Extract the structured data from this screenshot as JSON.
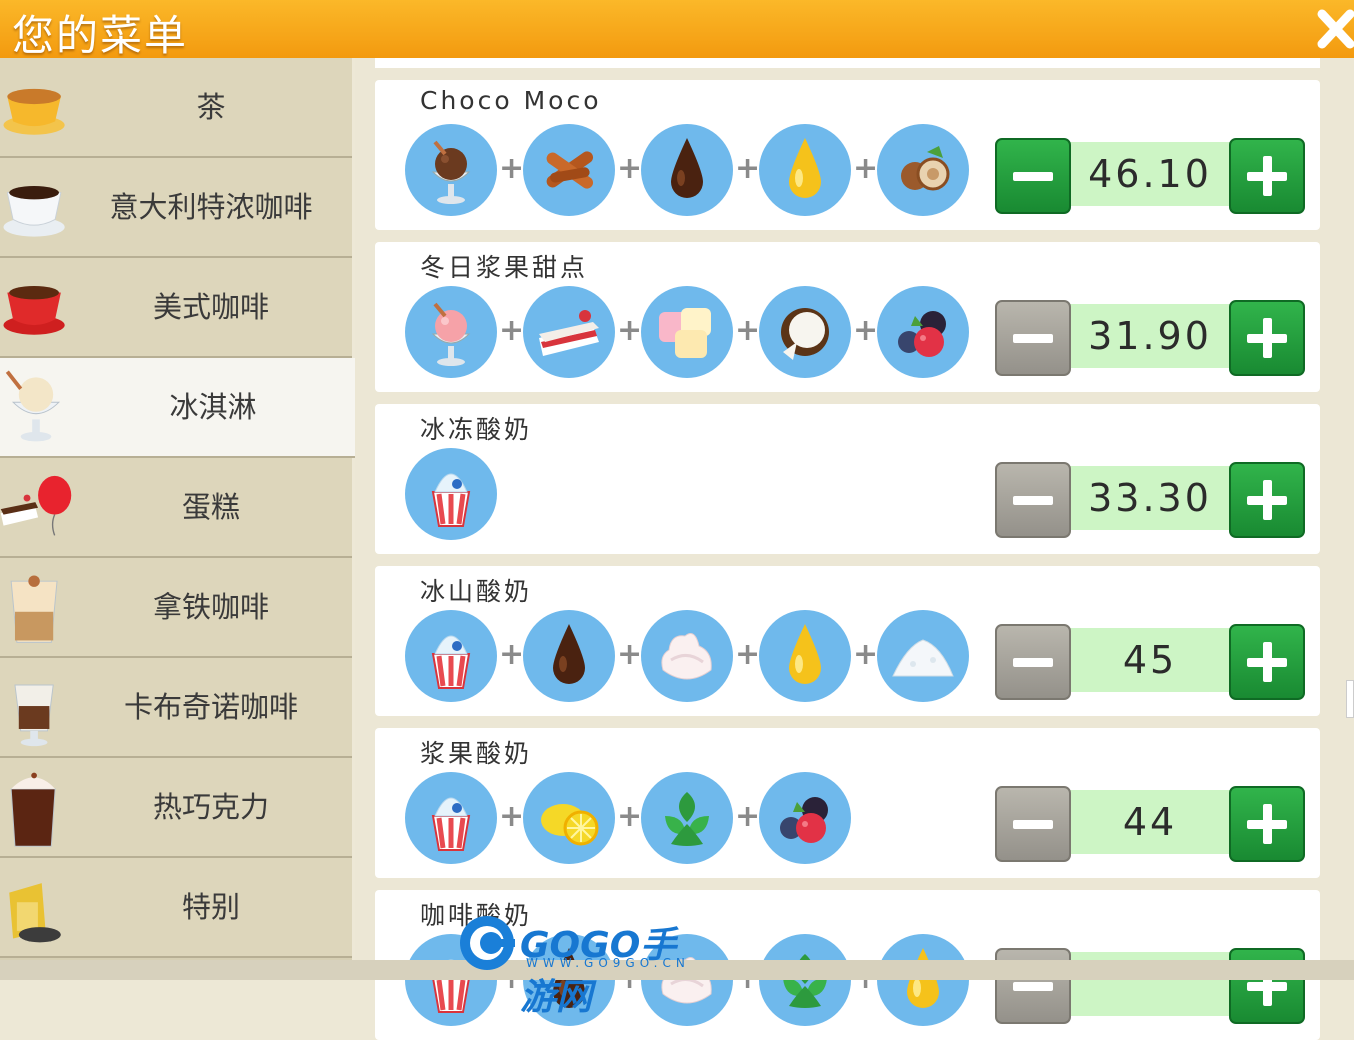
{
  "header": {
    "title": "您的菜单",
    "close_icon": "close-icon"
  },
  "sidebar": {
    "items": [
      {
        "label": "茶",
        "icon": "tea-cup-icon",
        "selected": false
      },
      {
        "label": "意大利特浓咖啡",
        "icon": "espresso-cup-icon",
        "selected": false
      },
      {
        "label": "美式咖啡",
        "icon": "americano-cup-icon",
        "selected": false
      },
      {
        "label": "冰淇淋",
        "icon": "ice-cream-icon",
        "selected": true
      },
      {
        "label": "蛋糕",
        "icon": "cake-balloon-icon",
        "selected": false
      },
      {
        "label": "拿铁咖啡",
        "icon": "latte-glass-icon",
        "selected": false
      },
      {
        "label": "卡布奇诺咖啡",
        "icon": "cappuccino-glass-icon",
        "selected": false
      },
      {
        "label": "热巧克力",
        "icon": "hot-chocolate-icon",
        "selected": false
      },
      {
        "label": "特别",
        "icon": "special-icon",
        "selected": false
      }
    ]
  },
  "recipes": [
    {
      "name": "Choco Moco",
      "price": "46.10",
      "minus_enabled": true,
      "ingredients": [
        "chocolate-ice-cream-icon",
        "cinnamon-icon",
        "chocolate-syrup-icon",
        "honey-drop-icon",
        "hazelnut-icon"
      ]
    },
    {
      "name": "冬日浆果甜点",
      "price": "31.90",
      "minus_enabled": false,
      "ingredients": [
        "strawberry-ice-cream-icon",
        "cake-slice-icon",
        "marshmallow-icon",
        "coconut-icon",
        "berries-icon"
      ]
    },
    {
      "name": "冰冻酸奶",
      "price": "33.30",
      "minus_enabled": false,
      "ingredients": [
        "frozen-yogurt-icon"
      ]
    },
    {
      "name": "冰山酸奶",
      "price": "45",
      "minus_enabled": false,
      "ingredients": [
        "frozen-yogurt-icon",
        "chocolate-syrup-icon",
        "whipped-cream-icon",
        "honey-drop-icon",
        "coconut-flakes-icon"
      ]
    },
    {
      "name": "浆果酸奶",
      "price": "44",
      "minus_enabled": false,
      "ingredients": [
        "frozen-yogurt-icon",
        "lemon-icon",
        "mint-icon",
        "berries-icon"
      ]
    },
    {
      "name": "咖啡酸奶",
      "price": "",
      "minus_enabled": false,
      "ingredients": [
        "frozen-yogurt-icon",
        "chocolate-syrup-icon",
        "whipped-cream-icon",
        "mint-icon",
        "honey-drop-icon"
      ]
    }
  ],
  "watermark": {
    "logo_text": "GOGO手游网",
    "url": "WWW.GO9GO.CN"
  },
  "colors": {
    "header": "#f7a91c",
    "selected_row": "#f6f5f0",
    "plus_button": "#22a03c",
    "minus_disabled": "#a8a59d",
    "price_band": "#cdf5c5",
    "ingredient_bg": "#6fb9ec"
  }
}
